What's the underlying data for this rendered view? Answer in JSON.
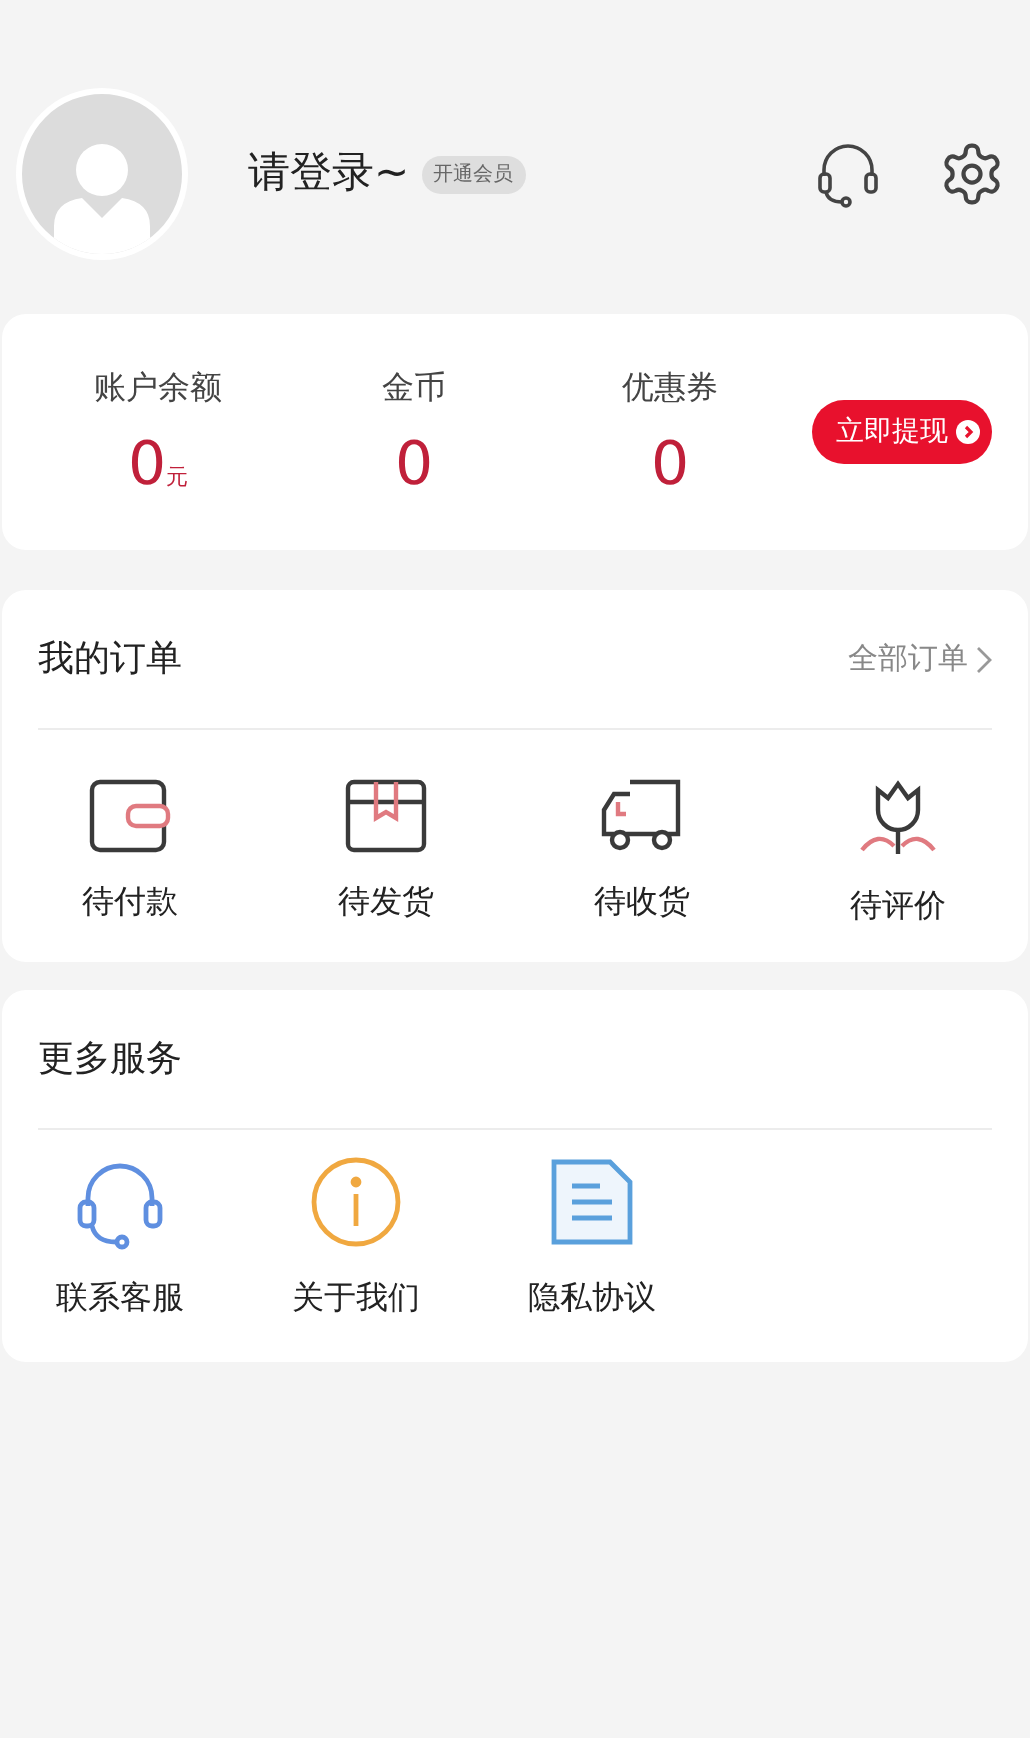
{
  "profile": {
    "name": "请登录~",
    "badge": "开通会员"
  },
  "account": {
    "stats": [
      {
        "label": "账户余额",
        "value": "0",
        "unit": "元"
      },
      {
        "label": "金币",
        "value": "0"
      },
      {
        "label": "优惠券",
        "value": "0"
      }
    ],
    "withdraw_button": "立即提现"
  },
  "orders": {
    "title": "我的订单",
    "all_link": "全部订单",
    "items": [
      {
        "kind": "wallet",
        "label": "待付款"
      },
      {
        "kind": "box",
        "label": "待发货"
      },
      {
        "kind": "truck",
        "label": "待收货"
      },
      {
        "kind": "flower",
        "label": "待评价"
      }
    ]
  },
  "services": {
    "title": "更多服务",
    "items": [
      {
        "kind": "headset",
        "label": "联系客服"
      },
      {
        "kind": "info",
        "label": "关于我们"
      },
      {
        "kind": "document",
        "label": "隐私协议"
      }
    ]
  }
}
